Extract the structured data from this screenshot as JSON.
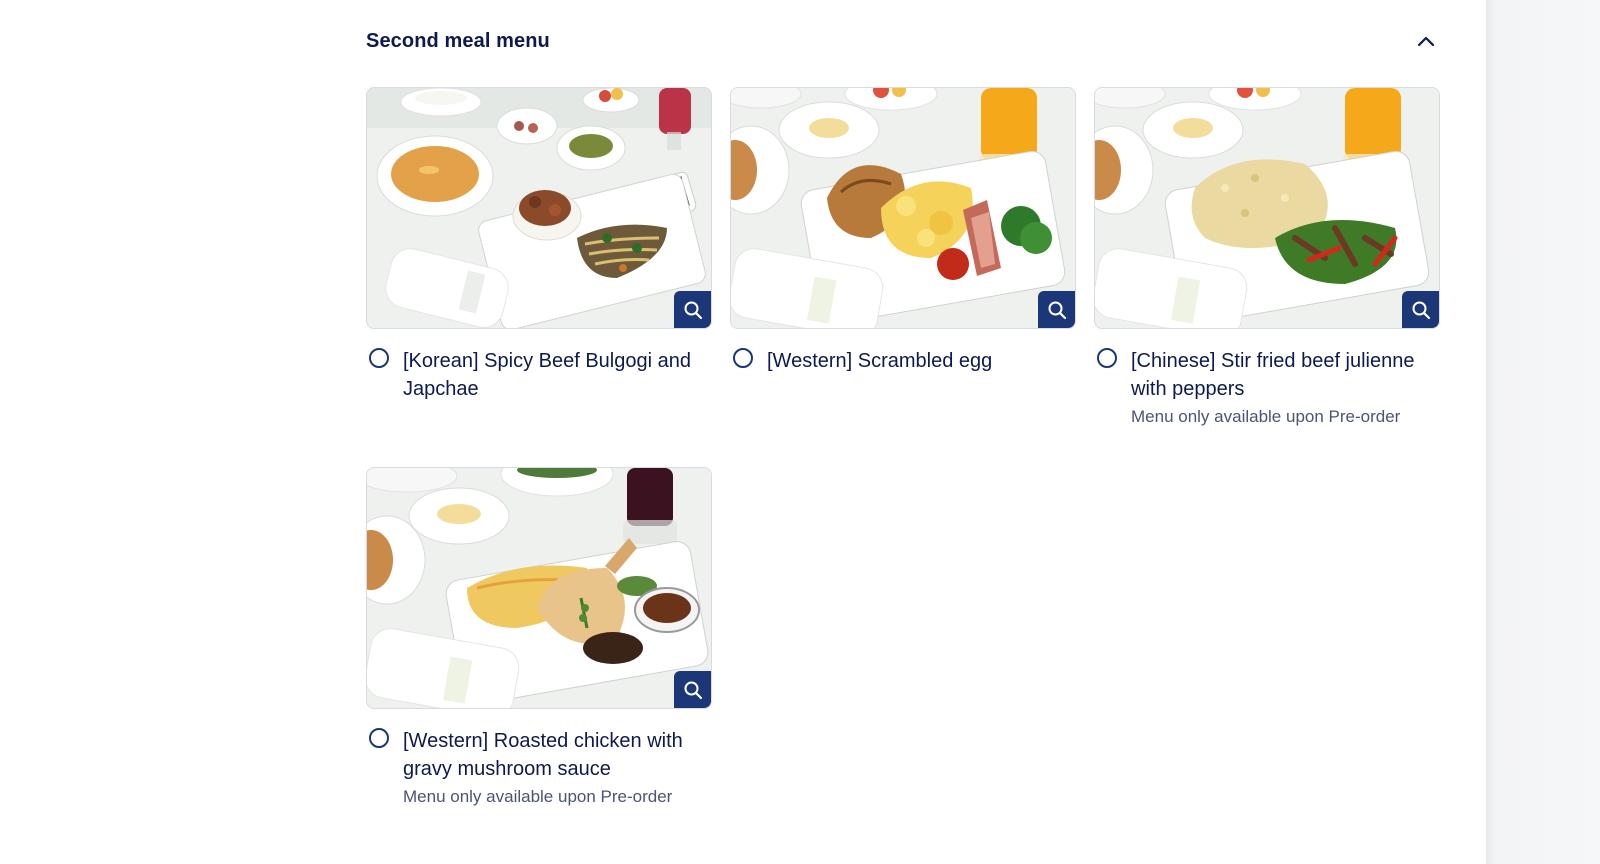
{
  "section": {
    "title": "Second meal menu",
    "collapse_icon": "chevron-up-icon"
  },
  "colors": {
    "title": "#0e1a4f",
    "accent": "#1c3777",
    "note": "#4a5573"
  },
  "meals": [
    {
      "label": "[Korean] Spicy Beef Bulgogi and Japchae",
      "note": "",
      "image": "korean-bulgogi-meal-photo",
      "zoom_icon": "magnifier-icon",
      "selected": false
    },
    {
      "label": "[Western] Scrambled egg",
      "note": "",
      "image": "scrambled-egg-meal-photo",
      "zoom_icon": "magnifier-icon",
      "selected": false
    },
    {
      "label": "[Chinese] Stir fried beef julienne with peppers",
      "note": "Menu only available upon Pre-order",
      "image": "stir-fried-beef-meal-photo",
      "zoom_icon": "magnifier-icon",
      "selected": false
    },
    {
      "label": "[Western] Roasted chicken with gravy mushroom sauce",
      "note": "Menu only available upon Pre-order",
      "image": "roasted-chicken-meal-photo",
      "zoom_icon": "magnifier-icon",
      "selected": false
    }
  ]
}
